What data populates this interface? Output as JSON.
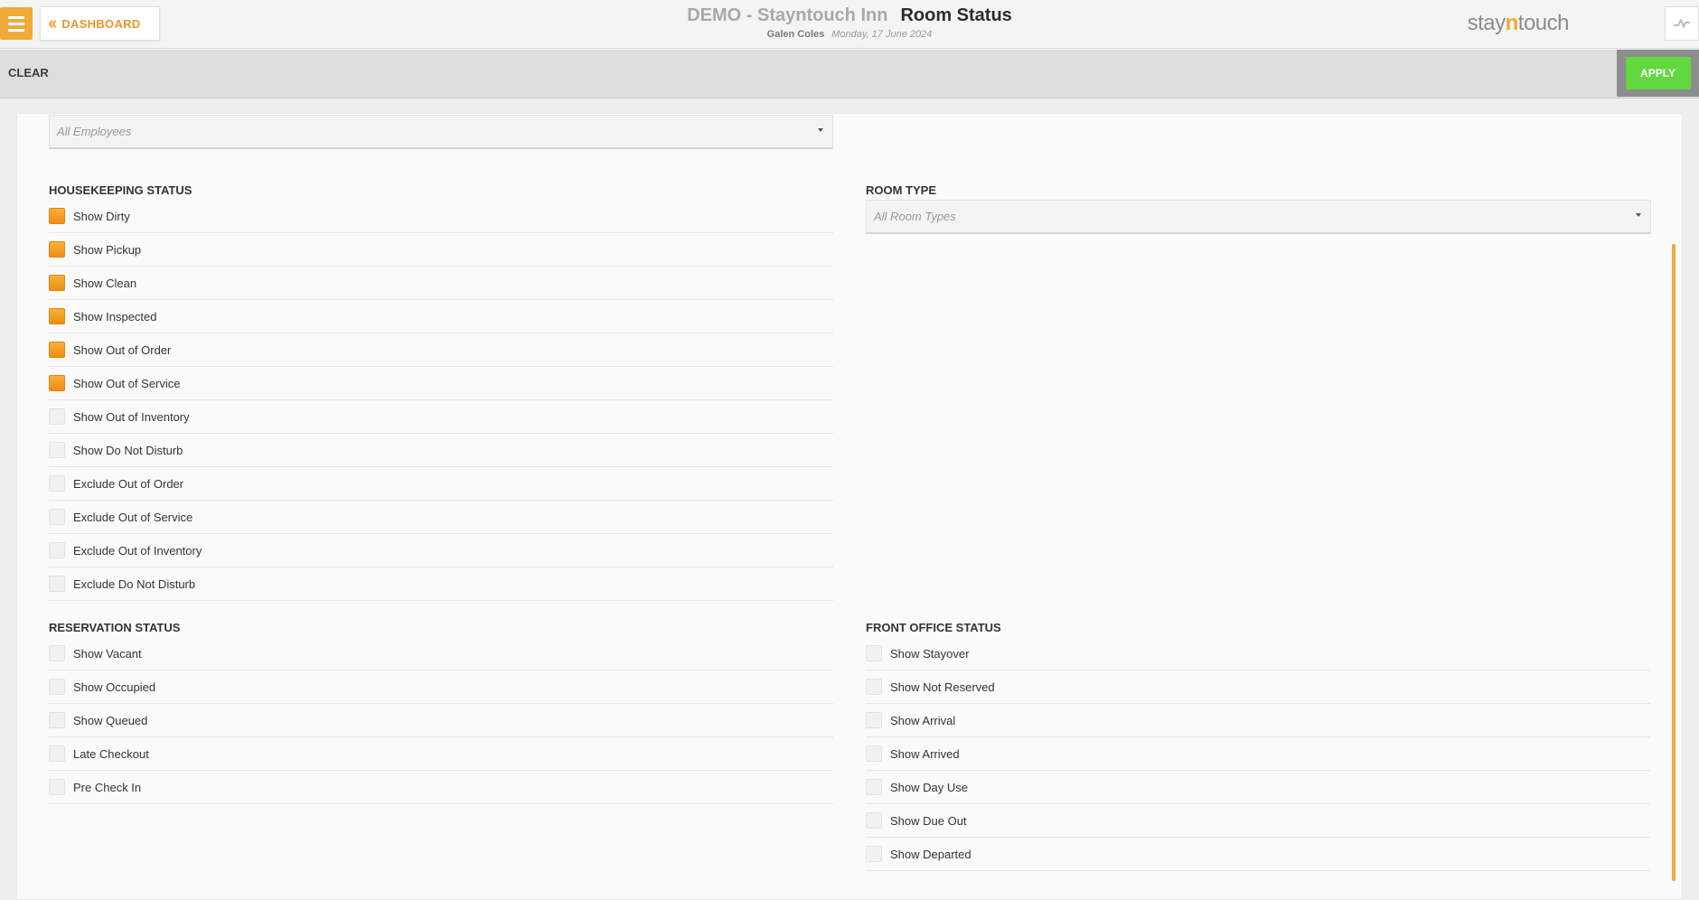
{
  "header": {
    "hotel_name": "DEMO - Stayntouch Inn",
    "page_title": "Room Status",
    "user": "Galen Coles",
    "date": "Monday, 17 June 2024",
    "back_label": "DASHBOARD",
    "brand": {
      "part1": "stay",
      "part2": "n",
      "part3": "touch"
    }
  },
  "toolbar": {
    "clear_label": "CLEAR",
    "apply_label": "APPLY"
  },
  "employee_select": {
    "value": "All Employees"
  },
  "housekeeping": {
    "title": "HOUSEKEEPING STATUS",
    "items": [
      {
        "label": "Show Dirty",
        "checked": true
      },
      {
        "label": "Show Pickup",
        "checked": true
      },
      {
        "label": "Show Clean",
        "checked": true
      },
      {
        "label": "Show Inspected",
        "checked": true
      },
      {
        "label": "Show Out of Order",
        "checked": true
      },
      {
        "label": "Show Out of Service",
        "checked": true
      },
      {
        "label": "Show Out of Inventory",
        "checked": false
      },
      {
        "label": "Show Do Not Disturb",
        "checked": false
      },
      {
        "label": "Exclude Out of Order",
        "checked": false
      },
      {
        "label": "Exclude Out of Service",
        "checked": false
      },
      {
        "label": "Exclude Out of Inventory",
        "checked": false
      },
      {
        "label": "Exclude Do Not Disturb",
        "checked": false
      }
    ]
  },
  "room_type": {
    "title": "ROOM TYPE",
    "value": "All Room Types"
  },
  "reservation": {
    "title": "RESERVATION STATUS",
    "items": [
      {
        "label": "Show Vacant",
        "checked": false
      },
      {
        "label": "Show Occupied",
        "checked": false
      },
      {
        "label": "Show Queued",
        "checked": false
      },
      {
        "label": "Late Checkout",
        "checked": false
      },
      {
        "label": "Pre Check In",
        "checked": false
      }
    ]
  },
  "front_office": {
    "title": "FRONT OFFICE STATUS",
    "items": [
      {
        "label": "Show Stayover",
        "checked": false
      },
      {
        "label": "Show Not Reserved",
        "checked": false
      },
      {
        "label": "Show Arrival",
        "checked": false
      },
      {
        "label": "Show Arrived",
        "checked": false
      },
      {
        "label": "Show Day Use",
        "checked": false
      },
      {
        "label": "Show Due Out",
        "checked": false
      },
      {
        "label": "Show Departed",
        "checked": false
      }
    ]
  },
  "colors": {
    "accent": "#f0a93b",
    "apply_green": "#61d83f"
  }
}
